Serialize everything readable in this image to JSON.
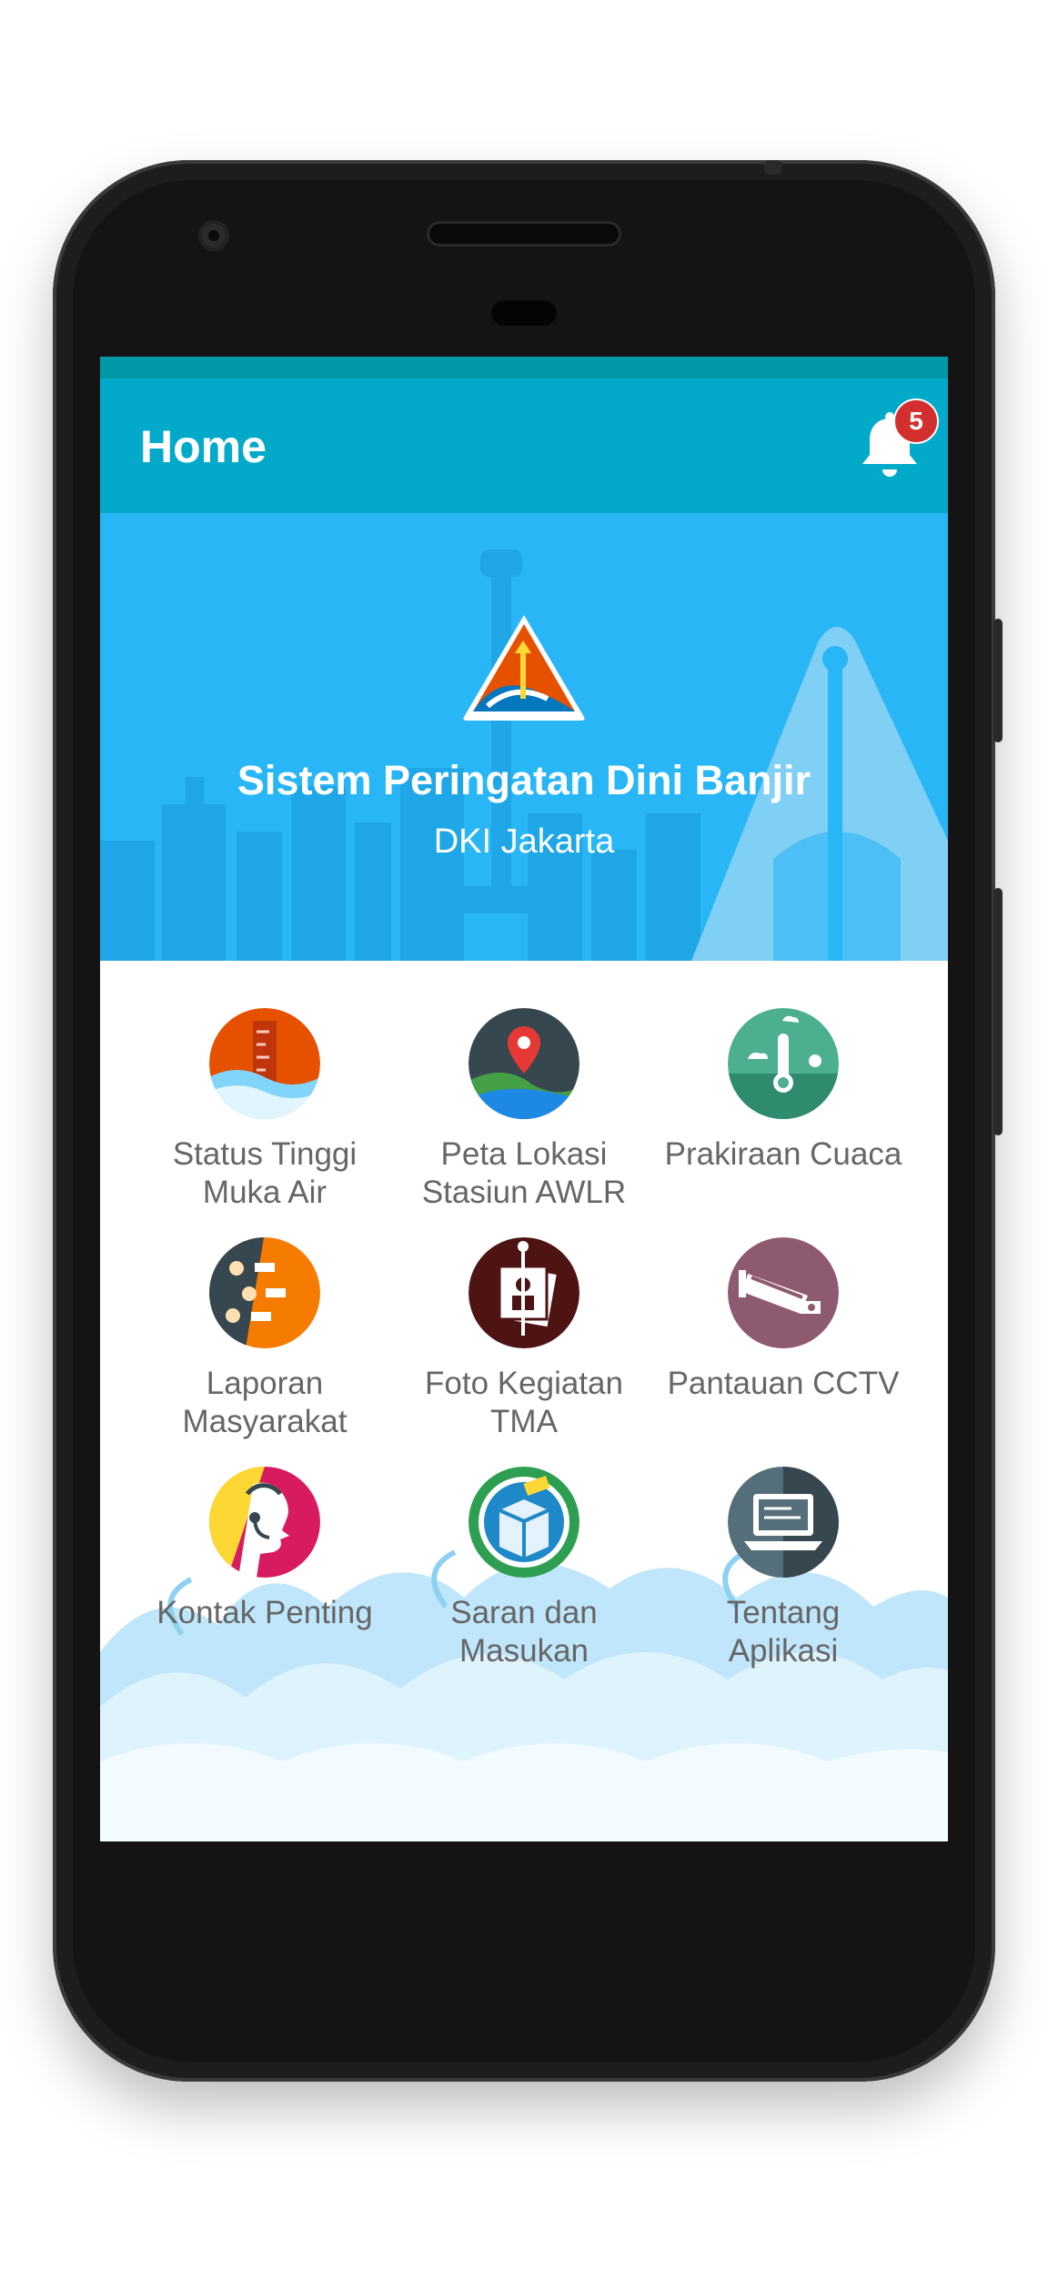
{
  "appbar": {
    "title": "Home",
    "notification_count": "5"
  },
  "hero": {
    "title": "Sistem Peringatan Dini Banjir",
    "subtitle": "DKI Jakarta"
  },
  "menu": [
    {
      "line1": "Status Tinggi",
      "line2": "Muka Air",
      "icon": "water-level-icon"
    },
    {
      "line1": "Peta Lokasi",
      "line2": "Stasiun AWLR",
      "icon": "map-pin-icon"
    },
    {
      "line1": "Prakiraan Cuaca",
      "line2": "",
      "icon": "weather-icon"
    },
    {
      "line1": "Laporan",
      "line2": "Masyarakat",
      "icon": "report-icon"
    },
    {
      "line1": "Foto Kegiatan",
      "line2": "TMA",
      "icon": "photo-icon"
    },
    {
      "line1": "Pantauan CCTV",
      "line2": "",
      "icon": "cctv-icon"
    },
    {
      "line1": "Kontak Penting",
      "line2": "",
      "icon": "contact-icon"
    },
    {
      "line1": "Saran dan",
      "line2": "Masukan",
      "icon": "suggestion-box-icon"
    },
    {
      "line1": "Tentang",
      "line2": "Aplikasi",
      "icon": "laptop-icon"
    }
  ]
}
